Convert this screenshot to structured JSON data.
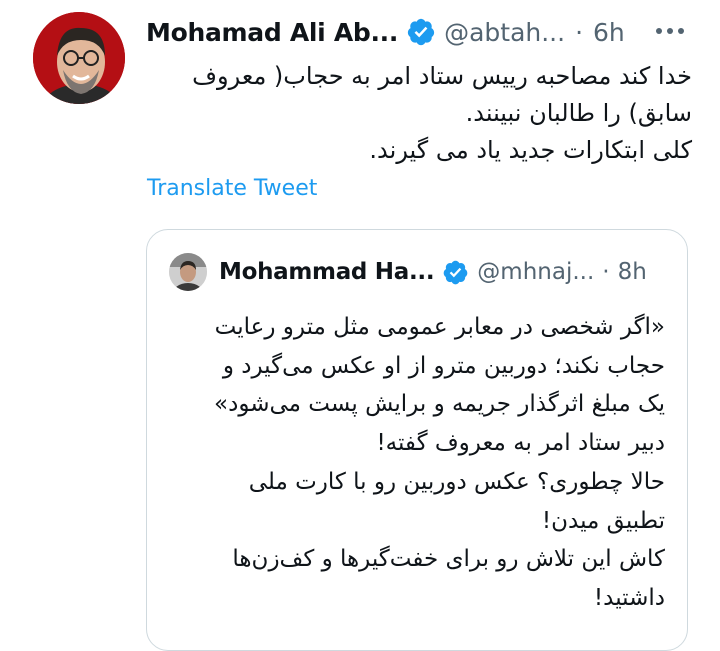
{
  "tweet": {
    "author_name": "Mohamad Ali Ab...",
    "handle": "@abtah...",
    "separator": "·",
    "time": "6h",
    "lines": [
      "خدا کند مصاحبه رییس ستاد امر به حجاب( معروف",
      "سابق) را طالبان نبینند.",
      "کلی ابتکارات جدید یاد می گیرند."
    ],
    "translate_label": "Translate Tweet"
  },
  "quote": {
    "author_name": "Mohammad Ha...",
    "handle": "@mhnaj...",
    "separator": "·",
    "time": "8h",
    "lines": [
      "«اگر شخصی در معابر عمومی مثل مترو رعایت",
      "حجاب نکند؛ دوربین مترو از او عکس می‌گیرد و",
      "یک مبلغ اثرگذار جریمه و برایش پست می‌شود»",
      "دبیر ستاد امر به معروف گفته!",
      "حالا چطوری؟ عکس دوربین رو با کارت ملی",
      "تطبیق میدن!",
      "کاش این تلاش رو برای خفت‌گیرها و کف‌زن‌ها",
      "داشتید!"
    ]
  },
  "colors": {
    "verified_blue": "#1d9bf0",
    "link_blue": "#1d9bf0",
    "muted_gray": "#536471",
    "border": "#cfd9de",
    "avatar_bg": "#b40f14"
  },
  "icons": {
    "verified": "verified-badge-icon",
    "more": "more-options-icon"
  }
}
